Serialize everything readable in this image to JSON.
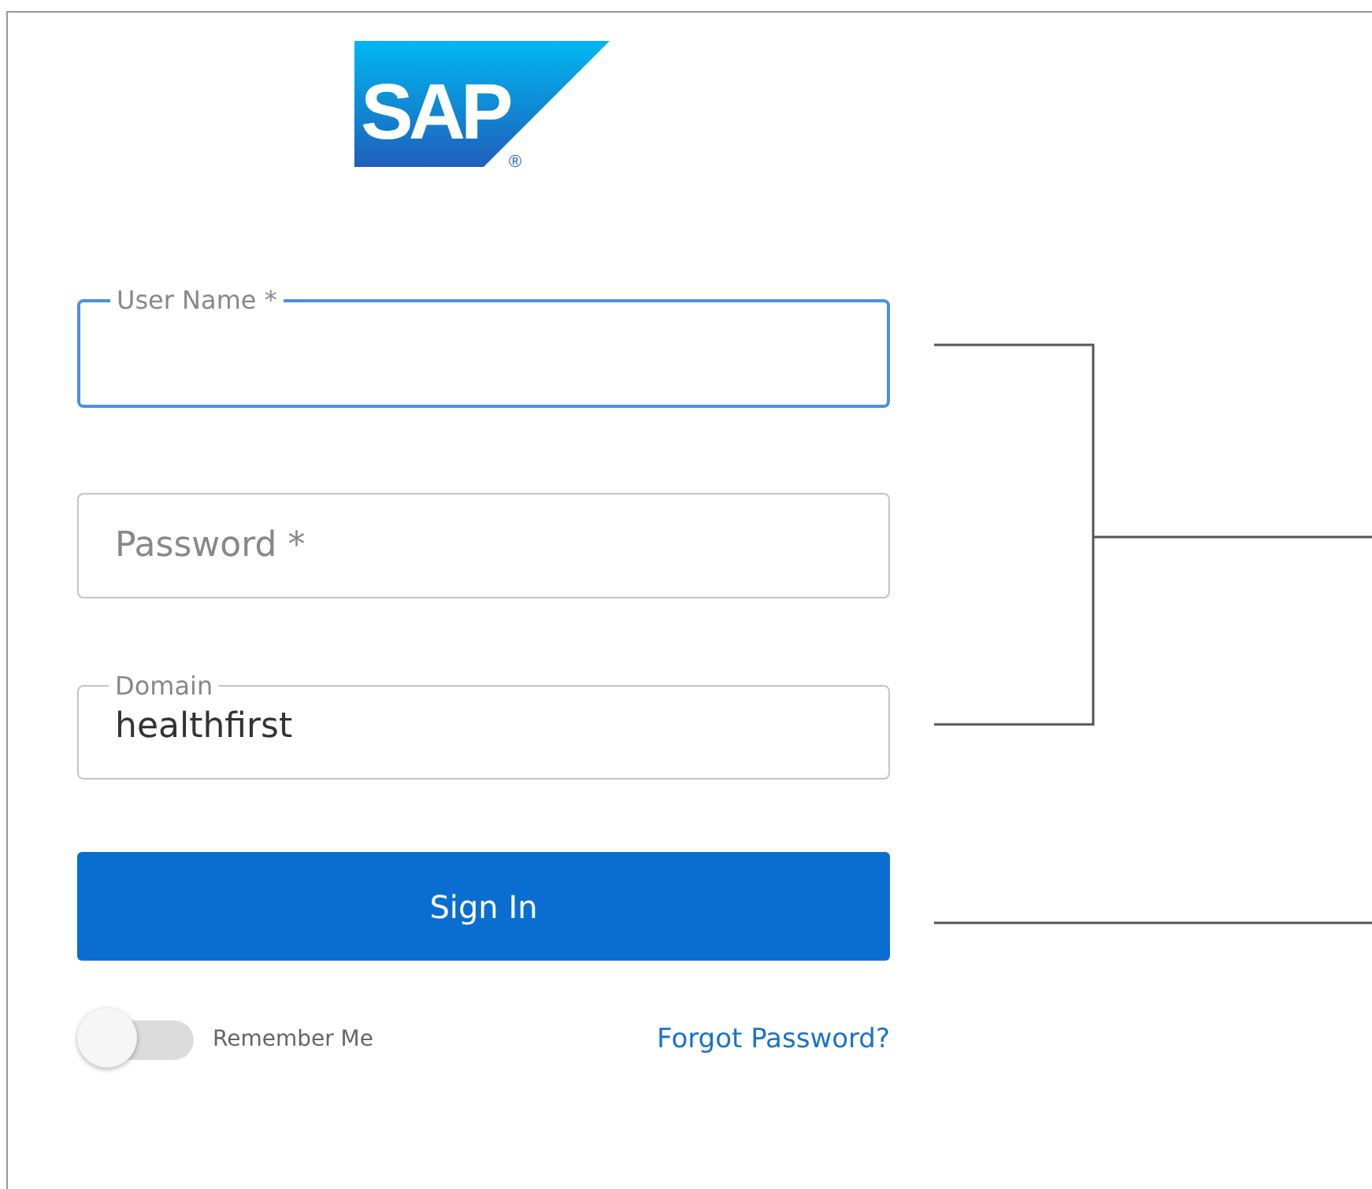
{
  "logo": {
    "text": "SAP",
    "mark": "®"
  },
  "fields": [
    {
      "kind": "floating",
      "label": "User Name *",
      "focused": true
    },
    {
      "kind": "placeholder",
      "placeholder": "Password *",
      "focused": false
    },
    {
      "kind": "floating",
      "label": "Domain",
      "value": "healthfirst",
      "focused": false
    }
  ],
  "sign_in_button": "Sign In",
  "remember_me": {
    "label": "Remember Me",
    "on": false
  },
  "forgot_password_link": "Forgot Password?"
}
